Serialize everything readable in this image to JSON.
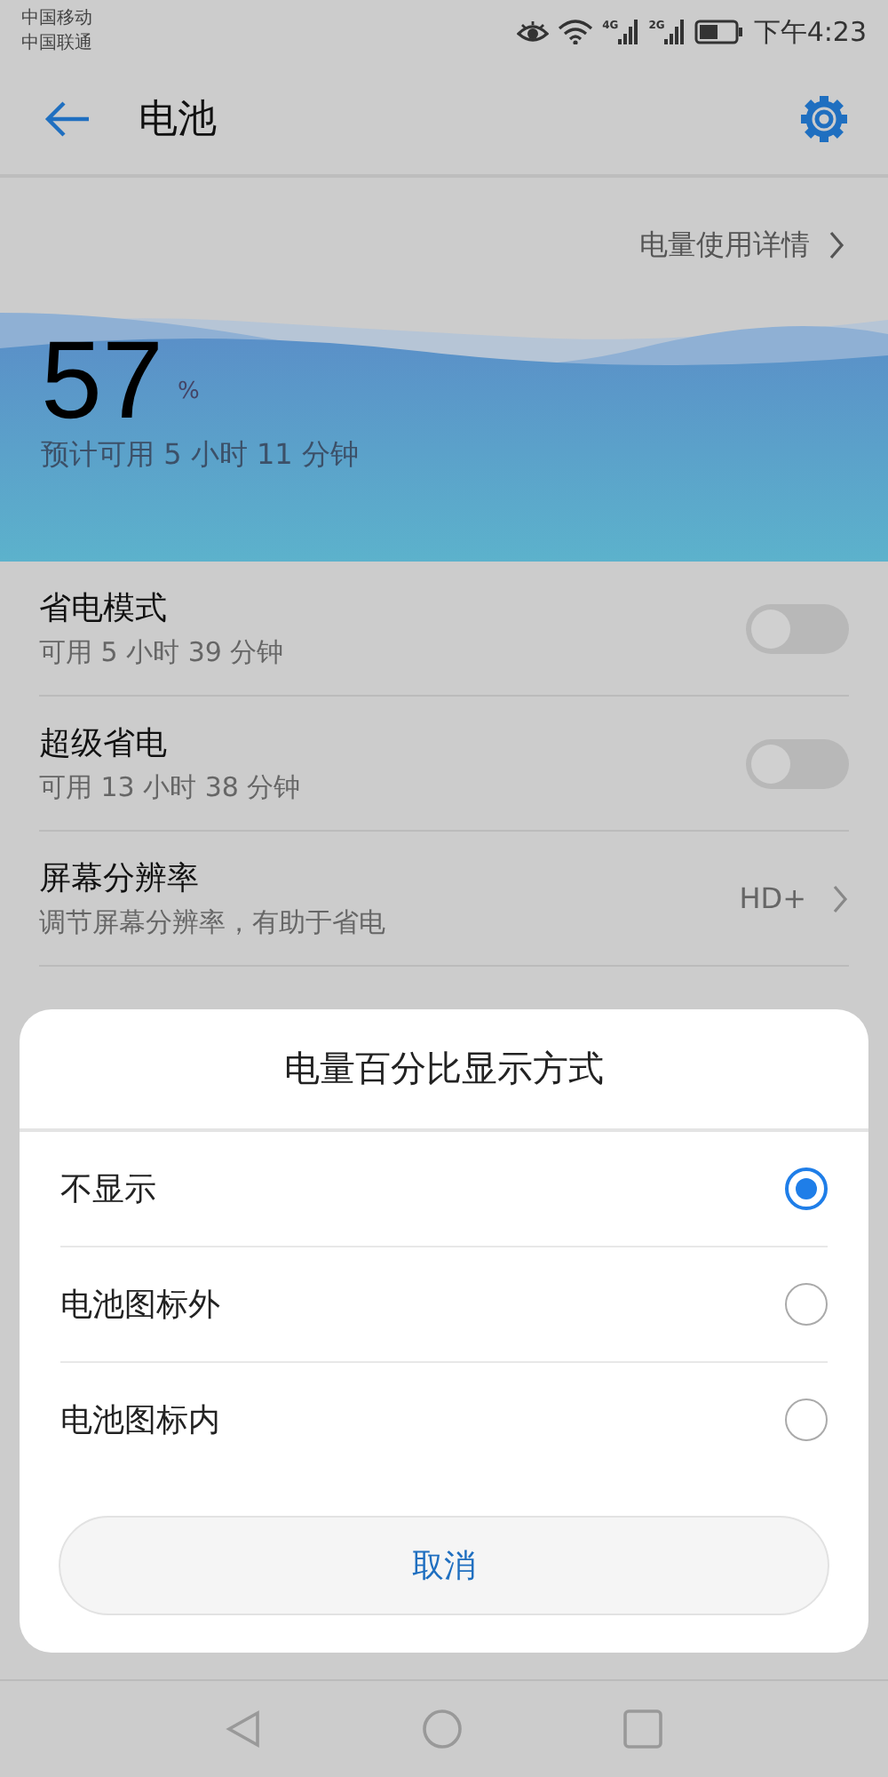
{
  "status_bar": {
    "carriers": [
      "中国移动",
      "中国联通"
    ],
    "network_labels": [
      "4G",
      "2G"
    ],
    "time": "下午4:23"
  },
  "app_bar": {
    "title": "电池"
  },
  "detail_link": {
    "label": "电量使用详情"
  },
  "battery": {
    "percent": "57",
    "unit": "%",
    "estimate": "预计可用 5 小时 11 分钟"
  },
  "settings": [
    {
      "kind": "switch",
      "title": "省电模式",
      "subtitle": "可用 5 小时 39 分钟",
      "on": false
    },
    {
      "kind": "switch",
      "title": "超级省电",
      "subtitle": "可用 13 小时 38 分钟",
      "on": false
    },
    {
      "kind": "link",
      "title": "屏幕分辨率",
      "subtitle": "调节屏幕分辨率，有助于省电",
      "value": "HD+"
    }
  ],
  "dialog": {
    "title": "电量百分比显示方式",
    "options": [
      {
        "label": "不显示",
        "selected": true
      },
      {
        "label": "电池图标外",
        "selected": false
      },
      {
        "label": "电池图标内",
        "selected": false
      }
    ],
    "cancel": "取消"
  }
}
